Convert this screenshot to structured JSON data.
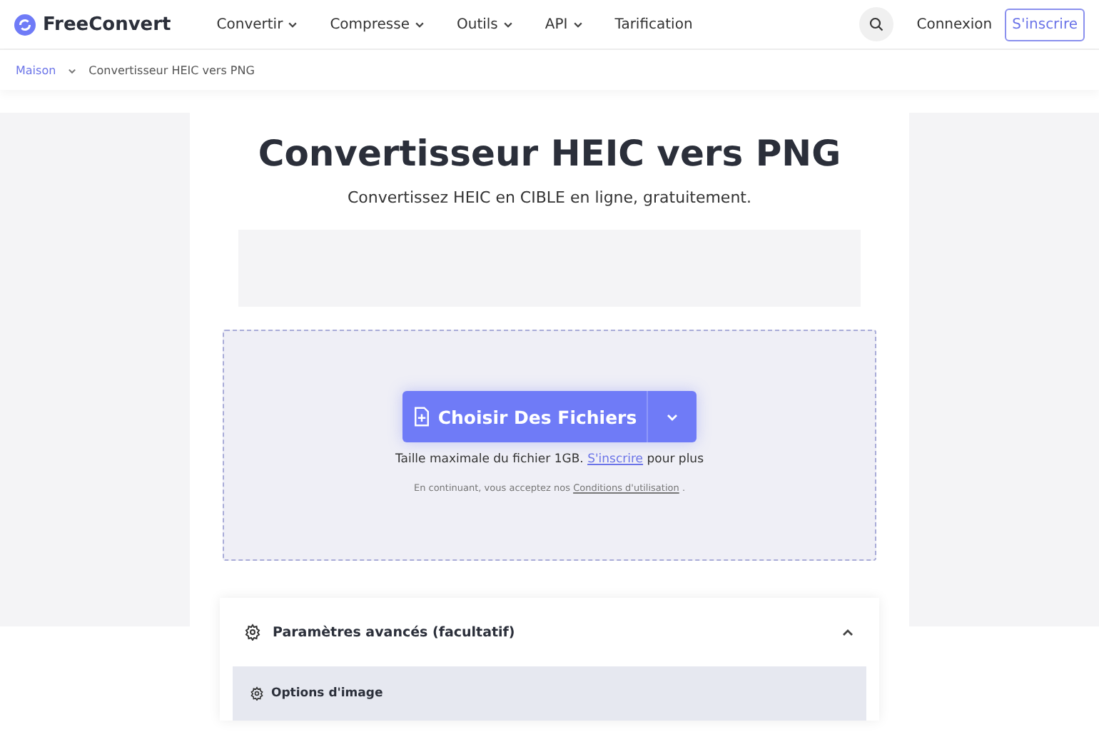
{
  "header": {
    "logo": "FreeConvert",
    "nav": [
      {
        "label": "Convertir",
        "has_menu": true
      },
      {
        "label": "Compresse",
        "has_menu": true
      },
      {
        "label": "Outils",
        "has_menu": true
      },
      {
        "label": "API",
        "has_menu": true
      },
      {
        "label": "Tarification",
        "has_menu": false
      }
    ],
    "login": "Connexion",
    "signup": "S'inscrire"
  },
  "breadcrumb": [
    "Maison",
    "Convertisseur HEIC vers PNG"
  ],
  "title": "Convertisseur HEIC vers PNG",
  "subtitle": "Convertissez HEIC en CIBLE en ligne, gratuitement.",
  "upload": {
    "button": "Choisir Des Fichiers",
    "size_text": "Taille maximale du fichier 1GB.",
    "size_link": "S'inscrire",
    "size_after": "pour plus",
    "terms_text": "En continuant, vous acceptez nos",
    "terms_link": "Conditions d'utilisation",
    "terms_end": "."
  },
  "advanced": {
    "title": "Paramètres avancés (facultatif)",
    "expanded": true,
    "sections": [
      "Options d'image"
    ]
  }
}
